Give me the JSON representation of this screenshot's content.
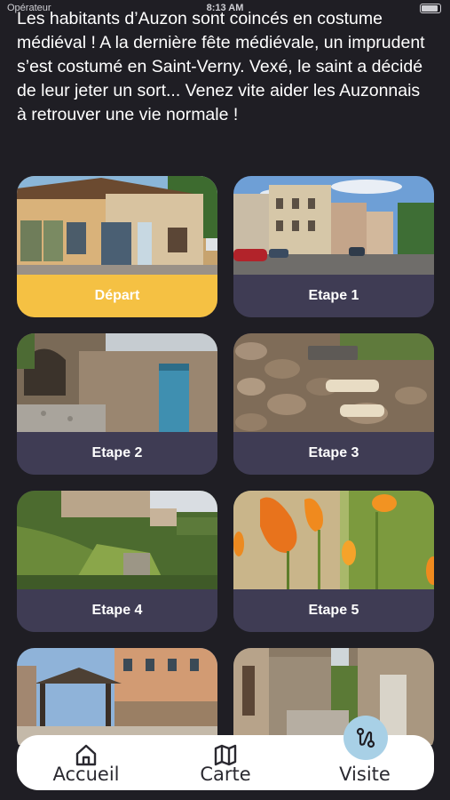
{
  "status": {
    "carrier": "Opérateur",
    "time": "8:13 AM"
  },
  "intro": {
    "text": "Les habitants d’Auzon sont coincés en costume médiéval ! A la dernière fête médiévale, un imprudent s’est costumé en Saint-Verny. Vexé, le saint a décidé de leur jeter un sort... Venez vite aider les Auzonnais à retrouver une vie normale !"
  },
  "steps": [
    {
      "label": "Départ",
      "image": "village-shop-photo"
    },
    {
      "label": "Etape 1",
      "image": "village-street-photo"
    },
    {
      "label": "Etape 2",
      "image": "stone-wall-blue-door-photo"
    },
    {
      "label": "Etape 3",
      "image": "stone-wall-signs-photo"
    },
    {
      "label": "Etape 4",
      "image": "hillside-village-photo"
    },
    {
      "label": "Etape 5",
      "image": "orange-poppies-photo"
    },
    {
      "label": "",
      "image": "covered-market-photo"
    },
    {
      "label": "",
      "image": "narrow-alley-photo"
    }
  ],
  "colors": {
    "background": "#1f1e24",
    "card": "#3f3c54",
    "accent": "#f5c143",
    "tabbar": "#ffffff",
    "active_tab": "#a8d0e6"
  },
  "tabbar": {
    "tabs": [
      {
        "label": "Accueil",
        "icon": "home-icon"
      },
      {
        "label": "Carte",
        "icon": "map-icon"
      },
      {
        "label": "Visite",
        "icon": "route-icon"
      }
    ],
    "active": "Visite"
  }
}
